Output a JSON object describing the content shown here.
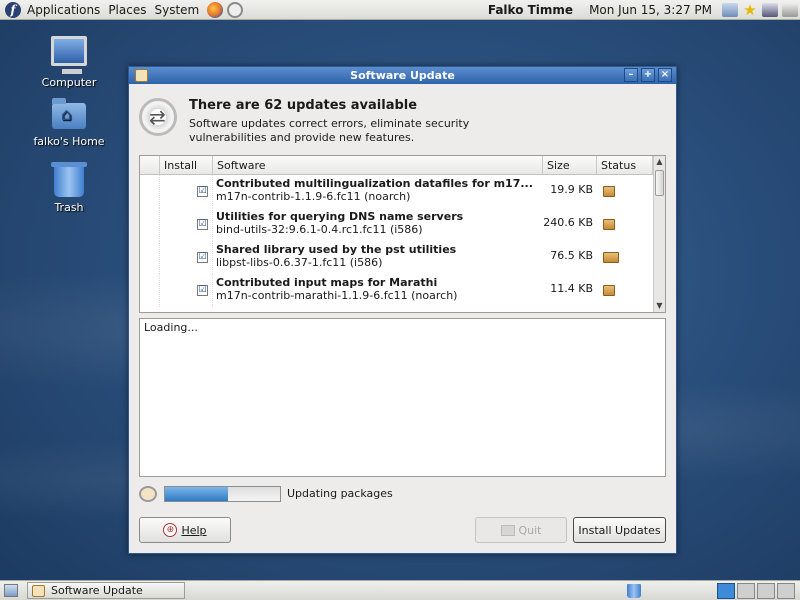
{
  "top_panel": {
    "menus": [
      "Applications",
      "Places",
      "System"
    ],
    "user": "Falko Timme",
    "clock": "Mon Jun 15,  3:27 PM"
  },
  "desktop_icons": [
    {
      "label": "Computer"
    },
    {
      "label": "falko's Home"
    },
    {
      "label": "Trash"
    }
  ],
  "window": {
    "title": "Software Update",
    "headline": "There are 62 updates available",
    "subtext": "Software updates correct errors, eliminate security vulnerabilities and provide new features.",
    "columns": {
      "install": "Install",
      "software": "Software",
      "size": "Size",
      "status": "Status"
    },
    "packages": [
      {
        "title": "Contributed multilingualization datafiles for m17...",
        "subtitle": "m17n-contrib-1.1.9-6.fc11 (noarch)",
        "size": "19.9 KB",
        "checked": true
      },
      {
        "title": "Utilities for querying DNS name servers",
        "subtitle": "bind-utils-32:9.6.1-0.4.rc1.fc11 (i586)",
        "size": "240.6 KB",
        "checked": true
      },
      {
        "title": "Shared library used by the pst utilities",
        "subtitle": "libpst-libs-0.6.37-1.fc11 (i586)",
        "size": "76.5 KB",
        "checked": true
      },
      {
        "title": "Contributed input maps for Marathi",
        "subtitle": "m17n-contrib-marathi-1.1.9-6.fc11 (noarch)",
        "size": "11.4 KB",
        "checked": true
      }
    ],
    "check_mark": "☑",
    "log_text": "Loading...",
    "progress": {
      "fraction": 0.55,
      "label": "Updating packages"
    },
    "buttons": {
      "help": "Help",
      "quit": "Quit",
      "install": "Install Updates"
    }
  },
  "taskbar": {
    "task": "Software Update"
  },
  "colors": {
    "titlebar": "#3a6fb4",
    "progress": "#2f7bc4"
  }
}
